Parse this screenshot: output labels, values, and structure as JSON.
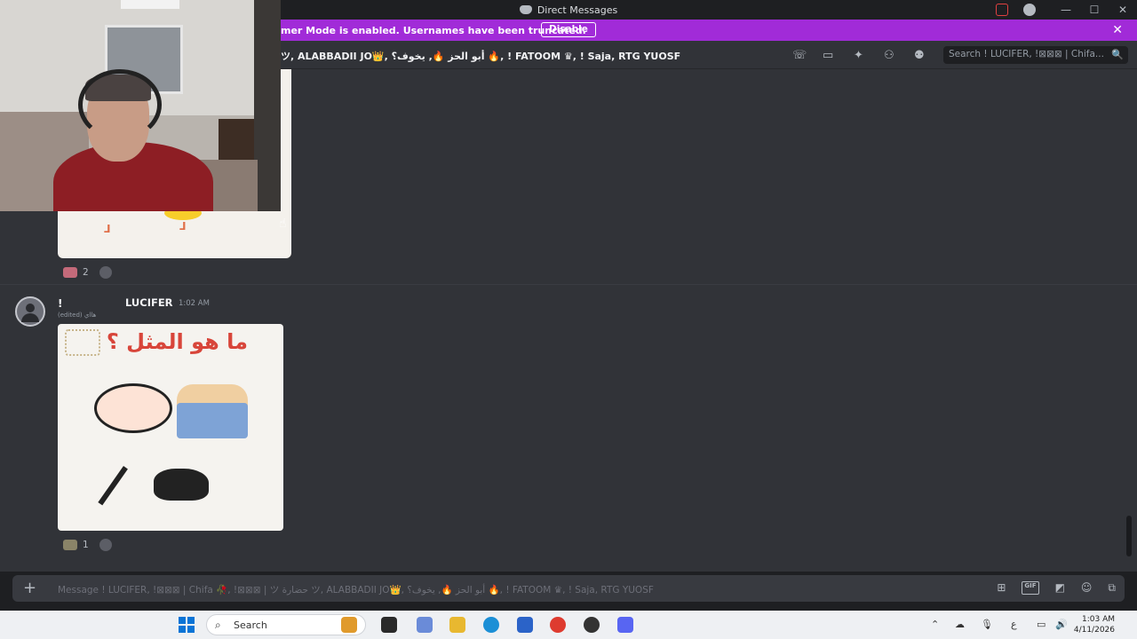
{
  "window": {
    "title": "Direct Messages",
    "controls": [
      "—",
      "☐",
      "✕"
    ]
  },
  "banner": {
    "text": "mer Mode is enabled. Usernames have been truncated.",
    "button_label": "Disable",
    "close": "✕"
  },
  "header": {
    "recipients": "ツ, ALABBADII JO👑, أبو الحز 🔥, يخوف؟ 🔥, ! FATOOM ♛, ! Saja, RTG YUOSF",
    "search_placeholder": "Search ! LUCIFER, !⊠⊠⊠ | Chifa...",
    "search_icon": "🔍"
  },
  "messages": [
    {
      "type": "image",
      "reactions": [
        {
          "count": "2"
        }
      ]
    },
    {
      "avatar": "default-avatar",
      "author_prefix": "!",
      "author": "LUCIFER",
      "timestamp": "1:02 AM",
      "edited_label": "(edited)",
      "extra_text": "هااي",
      "image_caption": "ما هو المثل ؟",
      "reactions": [
        {
          "count": "1"
        }
      ]
    }
  ],
  "composer": {
    "plus": "+",
    "placeholder": "Message ! LUCIFER, !⊠⊠⊠ | Chifa 🥀, !⊠⊠⊠ | ツ حضارة ツ, ALABBADII JO👑, أبو الحز 🔥, يخوف؟ 🔥, ! FATOOM ♛, ! Saja, RTG YUOSF",
    "gif_label": "GIF"
  },
  "taskbar": {
    "search_label": "Search",
    "ime_label": "ع",
    "time": "1:03 AM",
    "date": "4/11/2026"
  },
  "colors": {
    "banner": "#a12bd8",
    "chat_bg": "#313338",
    "accent": "#5865f2"
  }
}
